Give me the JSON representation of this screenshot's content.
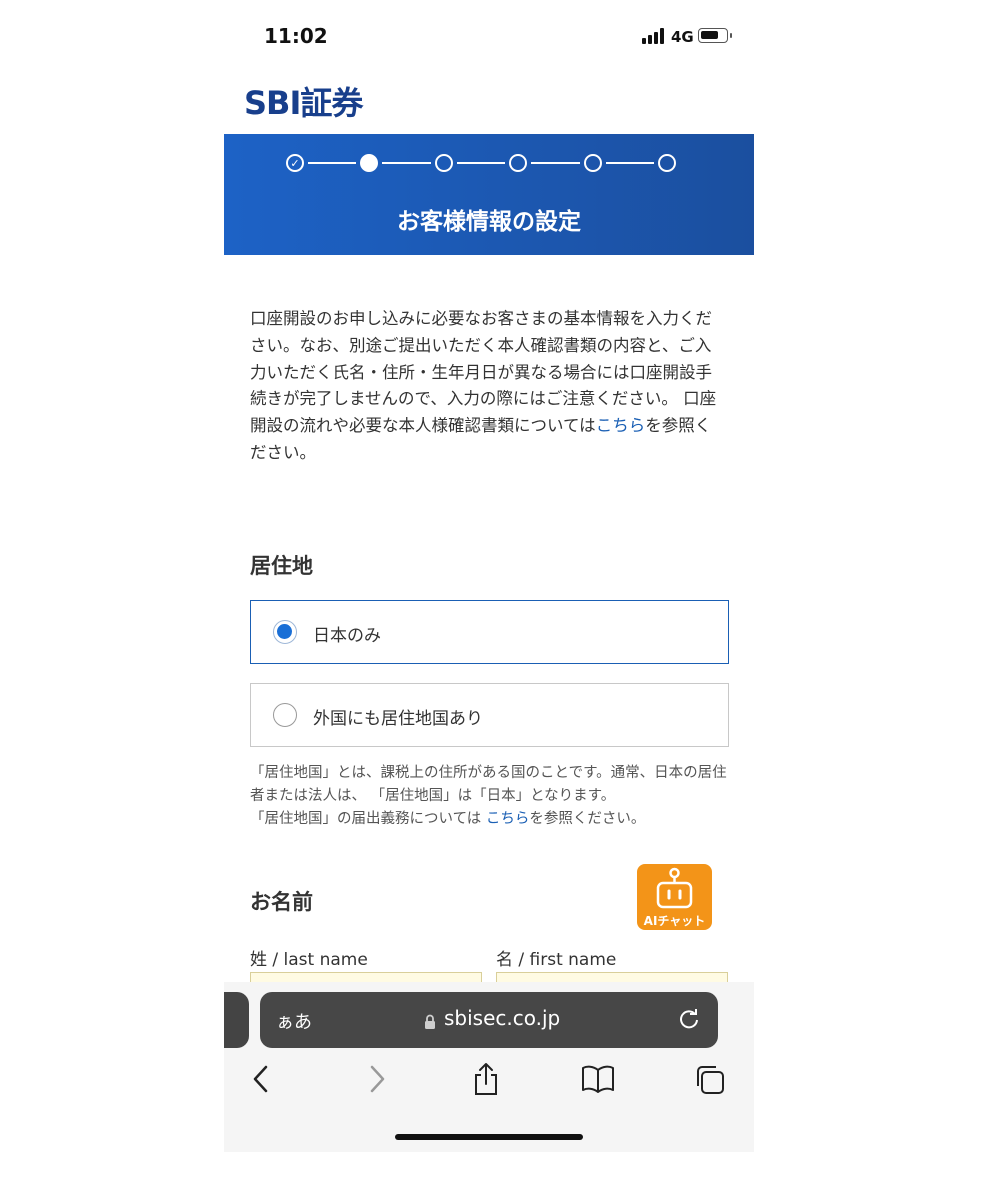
{
  "status": {
    "time": "11:02",
    "network": "4G",
    "battery_level": 0.75
  },
  "logo": "SBI証券",
  "progress": {
    "total_steps": 6,
    "completed_steps": 1,
    "current_step": 2
  },
  "banner_title": "お客様情報の設定",
  "intro": {
    "text": "口座開設のお申し込みに必要なお客さまの基本情報を入力ください。なお、別途ご提出いただく本人確認書類の内容と、ご入力いただく氏名・住所・生年月日が異なる場合には口座開設手続きが完了しませんので、入力の際にはご注意ください。 口座開設の流れや必要な本人様確認書類については",
    "link": "こちら",
    "tail": "を参照ください。"
  },
  "residence": {
    "heading": "居住地",
    "options": [
      {
        "label": "日本のみ",
        "selected": true
      },
      {
        "label": "外国にも居住地国あり",
        "selected": false
      }
    ],
    "note_line1": "「居住地国」とは、課税上の住所がある国のことです。通常、日本の居住者または法人は、 「居住地国」は「日本」となります。",
    "note_line2_pre": "「居住地国」の届出義務については ",
    "note_link": "こちら",
    "note_line2_post": "を参照ください。"
  },
  "name_section": {
    "heading": "お名前",
    "last_label": "姓 / last name",
    "first_label": "名 / first name"
  },
  "ai_chat": {
    "label": "AIチャット",
    "color": "#f39418"
  },
  "browser": {
    "aa": "ぁあ",
    "domain": "sbisec.co.jp",
    "toolbar_icons": [
      "back-icon",
      "forward-icon",
      "share-icon",
      "bookmarks-icon",
      "tabs-icon"
    ]
  },
  "colors": {
    "brand": "#183f8c",
    "banner": "#1d62c6",
    "link": "#1a5fb4"
  }
}
